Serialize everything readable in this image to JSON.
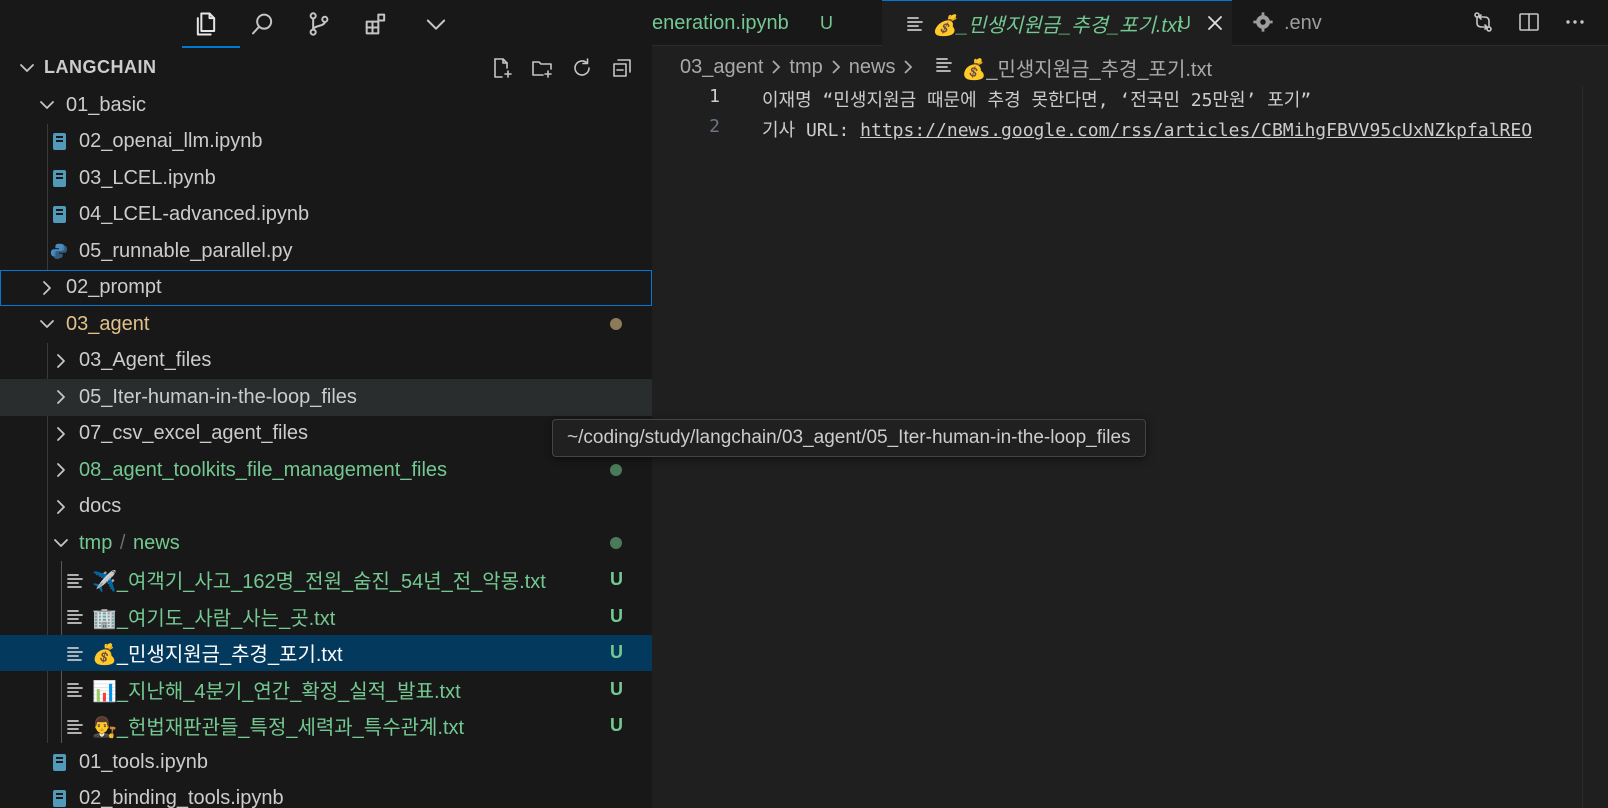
{
  "explorer": {
    "title": "LANGCHAIN"
  },
  "tree": {
    "basic": {
      "label": "01_basic"
    },
    "basic_files": [
      {
        "label": "02_openai_llm.ipynb"
      },
      {
        "label": "03_LCEL.ipynb"
      },
      {
        "label": "04_LCEL-advanced.ipynb"
      },
      {
        "label": "05_runnable_parallel.py"
      }
    ],
    "prompt": {
      "label": "02_prompt"
    },
    "agent": {
      "label": "03_agent"
    },
    "agent_folders": [
      {
        "label": "03_Agent_files"
      },
      {
        "label": "05_Iter-human-in-the-loop_files"
      },
      {
        "label": "07_csv_excel_agent_files"
      },
      {
        "label": "08_agent_toolkits_file_management_files"
      },
      {
        "label": "docs"
      }
    ],
    "tmp": {
      "label": "tmp",
      "sep": "/",
      "sub": "news"
    },
    "news_files": [
      {
        "label": "✈️_여객기_사고_162명_전원_숨진_54년_전_악몽.txt",
        "badge": "U"
      },
      {
        "label": "🏢_여기도_사람_사는_곳.txt",
        "badge": "U"
      },
      {
        "label": "💰_민생지원금_추경_포기.txt",
        "badge": "U"
      },
      {
        "label": "📊_지난해_4분기_연간_확정_실적_발표.txt",
        "badge": "U"
      },
      {
        "label": "👨‍⚖️_헌법재판관들_특정_세력과_특수관계.txt",
        "badge": "U"
      }
    ],
    "agent_files": [
      {
        "label": "01_tools.ipynb"
      },
      {
        "label": "02_binding_tools.ipynb"
      }
    ]
  },
  "tabs": [
    {
      "label": "eneration.ipynb",
      "badge": "U"
    },
    {
      "label": "💰_민생지원금_추경_포기.txt",
      "badge": "U"
    },
    {
      "label": ".env"
    }
  ],
  "breadcrumb": {
    "parts": [
      "03_agent",
      "tmp",
      "news"
    ],
    "file": "💰_민생지원금_추경_포기.txt"
  },
  "editor": {
    "lines": [
      {
        "num": "1",
        "text": "이재명 “민생지원금 때문에 추경 못한다면, ‘전국민 25만원’ 포기”"
      },
      {
        "num": "2",
        "prefix": "기사 URL: ",
        "url": "https://news.google.com/rss/articles/CBMihgFBVV95cUxNZkpfalREO"
      }
    ]
  },
  "tooltip": {
    "text": "~/coding/study/langchain/03_agent/05_Iter-human-in-the-loop_files"
  },
  "colors": {
    "accent": "#0078d4",
    "untracked_green": "#73c991",
    "modified_yellow": "#e2c08d",
    "selected_row": "#04395e"
  }
}
